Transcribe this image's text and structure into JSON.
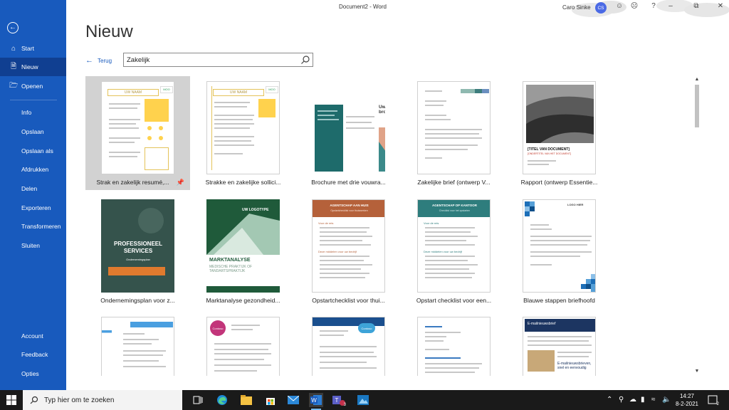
{
  "app": {
    "window_title": "Document2 - Word",
    "user_name": "Caro Sinke",
    "user_initials": "CS"
  },
  "sidebar": {
    "items": [
      {
        "label": "Start",
        "icon": "home-icon"
      },
      {
        "label": "Nieuw",
        "icon": "new-document-icon",
        "active": true
      },
      {
        "label": "Openen",
        "icon": "folder-icon"
      },
      {
        "label": "Info"
      },
      {
        "label": "Opslaan"
      },
      {
        "label": "Opslaan als"
      },
      {
        "label": "Afdrukken"
      },
      {
        "label": "Delen"
      },
      {
        "label": "Exporteren"
      },
      {
        "label": "Transformeren"
      },
      {
        "label": "Sluiten"
      }
    ],
    "bottom_items": [
      {
        "label": "Account"
      },
      {
        "label": "Feedback"
      },
      {
        "label": "Opties"
      }
    ]
  },
  "main": {
    "title": "Nieuw",
    "back_label": "Terug",
    "search_value": "Zakelijk"
  },
  "templates": [
    {
      "label": "Strak en zakelijk resumé,...",
      "selected": true
    },
    {
      "label": "Strakke en zakelijke sollici..."
    },
    {
      "label": "Brochure met drie vouwra..."
    },
    {
      "label": "Zakelijke brief (ontwerp V..."
    },
    {
      "label": "Rapport (ontwerp Essentie..."
    },
    {
      "label": "Ondernemingsplan voor z..."
    },
    {
      "label": "Marktanalyse gezondheid..."
    },
    {
      "label": "Opstartchecklist voor thui..."
    },
    {
      "label": "Opstart checklist voor een..."
    },
    {
      "label": "Blauwe stappen briefhoofd"
    }
  ],
  "thumb_text": {
    "resume_name": "UW NAAM",
    "moo": "MOO",
    "brochure_title": "Uw bedrijfs-brochure",
    "report_title": "[TITEL VAN DOCUMENT]",
    "report_subtitle": "[ONDERTITEL VAN HET DOCUMENT]",
    "plan_title": "PROFESSIONEEL SERVICES",
    "plan_subtitle": "Ondernemingsplan",
    "market_logo": "UW LOGOTYPE",
    "market_title": "MARKTANALYSE",
    "market_subtitle": "MEDISCHE PRAKTIJK OF TANDARTSPRAKTIJK",
    "checklist1_title": "AGENTSCHAP AAN HUIS",
    "checklist1_sub": "Opstartchecklist voor thuiswerken",
    "checklist2_title": "AGENTSCHAP OP KANTOOR",
    "checklist2_sub": "Checklist voor het opstarten",
    "section1": "Voor de reis",
    "section2": "Deze middelen voor uw bedrijf",
    "letterhead_logo": "LOGO HIER",
    "contoso": "Contoso",
    "newsletter_title": "E-mailnieuwsbrief",
    "newsletter_bottom": "E-mailnieuwsbrieven, snel en eenvoudig"
  },
  "taskbar": {
    "search_placeholder": "Typ hier om te zoeken",
    "time": "14:27",
    "date": "8-2-2021",
    "notification_count": "2",
    "teams_badge": "3"
  },
  "colors": {
    "word_blue": "#185abd",
    "selected_bg": "#d2d2d2",
    "resume_yellow": "#ffd24d",
    "brochure_teal": "#1e6b6b",
    "plan_orange": "#e07a2e",
    "market_green": "#1f5a3a",
    "letterhead_blue": "#1d6fb8"
  }
}
